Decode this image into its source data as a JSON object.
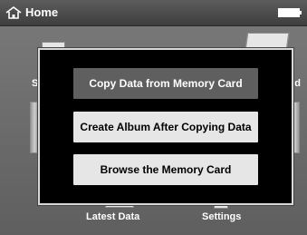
{
  "header": {
    "title": "Home",
    "home_icon": "home-icon",
    "battery_icon": "battery-icon"
  },
  "background": {
    "label_latest": "Latest Data",
    "label_settings": "Settings",
    "partial_left": "S",
    "partial_right": "rd"
  },
  "dialog": {
    "options": [
      {
        "label": "Copy Data from Memory Card",
        "selected": true
      },
      {
        "label": "Create Album After Copying Data",
        "selected": false
      },
      {
        "label": "Browse the Memory Card",
        "selected": false
      }
    ]
  },
  "colors": {
    "selected_bg": "#5f5f5f",
    "normal_bg": "#e6e6e6",
    "dialog_bg": "#000000",
    "header_bg": "#4a4a4a"
  }
}
